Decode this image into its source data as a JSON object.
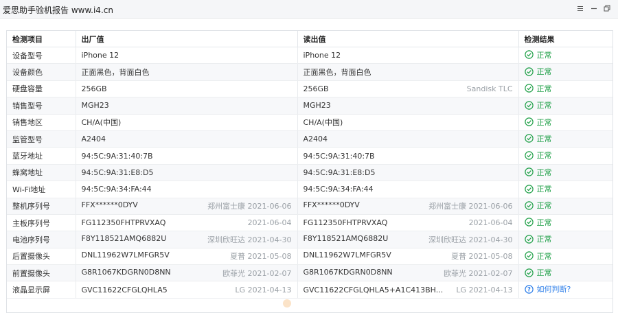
{
  "window": {
    "title": "爱思助手验机报告 www.i4.cn"
  },
  "table": {
    "headers": [
      "检测项目",
      "出厂值",
      "读出值",
      "检测结果"
    ],
    "rows": [
      {
        "item": "设备型号",
        "factory": "iPhone 12",
        "factory_meta": "",
        "read": "iPhone 12",
        "read_meta": "",
        "result": "正常",
        "status": "ok"
      },
      {
        "item": "设备颜色",
        "factory": "正面黑色，背面白色",
        "factory_meta": "",
        "read": "正面黑色，背面白色",
        "read_meta": "",
        "result": "正常",
        "status": "ok"
      },
      {
        "item": "硬盘容量",
        "factory": "256GB",
        "factory_meta": "",
        "read": "256GB",
        "read_meta": "Sandisk TLC",
        "result": "正常",
        "status": "ok"
      },
      {
        "item": "销售型号",
        "factory": "MGH23",
        "factory_meta": "",
        "read": "MGH23",
        "read_meta": "",
        "result": "正常",
        "status": "ok"
      },
      {
        "item": "销售地区",
        "factory": "CH/A(中国)",
        "factory_meta": "",
        "read": "CH/A(中国)",
        "read_meta": "",
        "result": "正常",
        "status": "ok"
      },
      {
        "item": "监管型号",
        "factory": "A2404",
        "factory_meta": "",
        "read": "A2404",
        "read_meta": "",
        "result": "正常",
        "status": "ok"
      },
      {
        "item": "蓝牙地址",
        "factory": "94:5C:9A:31:40:7B",
        "factory_meta": "",
        "read": "94:5C:9A:31:40:7B",
        "read_meta": "",
        "result": "正常",
        "status": "ok"
      },
      {
        "item": "蜂窝地址",
        "factory": "94:5C:9A:31:E8:D5",
        "factory_meta": "",
        "read": "94:5C:9A:31:E8:D5",
        "read_meta": "",
        "result": "正常",
        "status": "ok"
      },
      {
        "item": "Wi-Fi地址",
        "factory": "94:5C:9A:34:FA:44",
        "factory_meta": "",
        "read": "94:5C:9A:34:FA:44",
        "read_meta": "",
        "result": "正常",
        "status": "ok"
      },
      {
        "item": "整机序列号",
        "factory": "FFX******0DYV",
        "factory_meta": "郑州富士康 2021-06-06",
        "read": "FFX******0DYV",
        "read_meta": "郑州富士康 2021-06-06",
        "result": "正常",
        "status": "ok"
      },
      {
        "item": "主板序列号",
        "factory": "FG112350FHTPRVXAQ",
        "factory_meta": "2021-06-04",
        "read": "FG112350FHTPRVXAQ",
        "read_meta": "2021-06-04",
        "result": "正常",
        "status": "ok"
      },
      {
        "item": "电池序列号",
        "factory": "F8Y118521AMQ6882U",
        "factory_meta": "深圳欣旺达 2021-04-30",
        "read": "F8Y118521AMQ6882U",
        "read_meta": "深圳欣旺达 2021-04-30",
        "result": "正常",
        "status": "ok"
      },
      {
        "item": "后置摄像头",
        "factory": "DNL11962W7LMFGR5V",
        "factory_meta": "夏普 2021-05-08",
        "read": "DNL11962W7LMFGR5V",
        "read_meta": "夏普 2021-05-08",
        "result": "正常",
        "status": "ok"
      },
      {
        "item": "前置摄像头",
        "factory": "G8R1067KDGRN0D8NN",
        "factory_meta": "欧菲光 2021-02-07",
        "read": "G8R1067KDGRN0D8NN",
        "read_meta": "欧菲光 2021-02-07",
        "result": "正常",
        "status": "ok"
      },
      {
        "item": "液晶显示屏",
        "factory": "GVC11622CFGLQHLA5",
        "factory_meta": "LG 2021-04-13",
        "read": "GVC11622CFGLQHLA5+A1C413BH...",
        "read_meta": "LG 2021-04-13",
        "result": "如何判断?",
        "status": "question"
      }
    ]
  },
  "icons": {
    "ok": "check-circle-icon",
    "question": "question-circle-icon"
  },
  "colors": {
    "ok": "#20a048",
    "question": "#2b7de9"
  }
}
